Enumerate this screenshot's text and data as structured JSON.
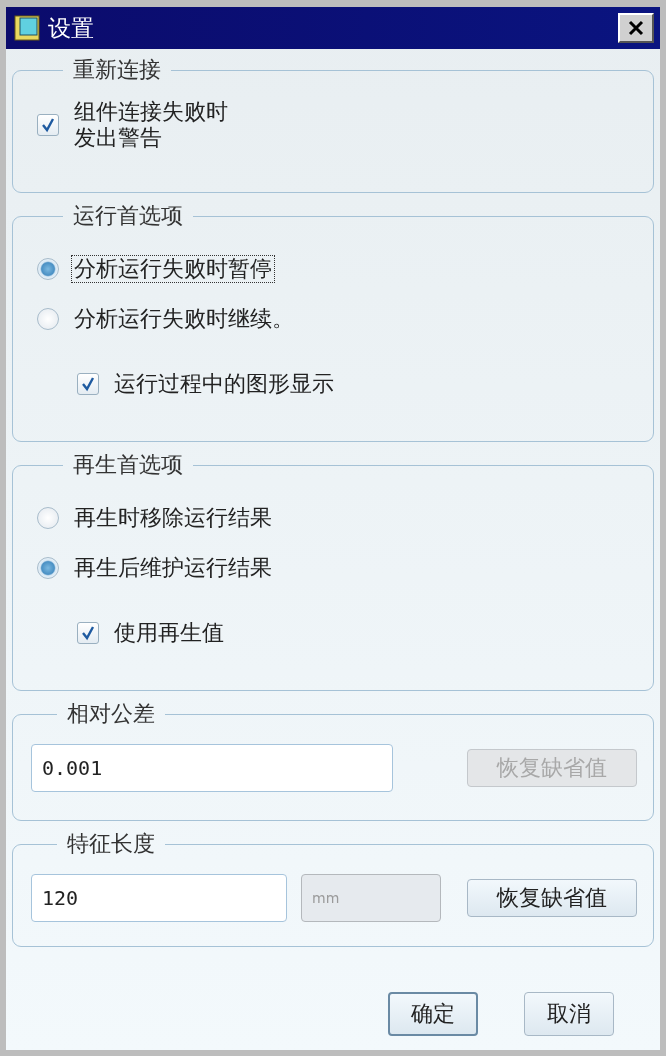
{
  "window": {
    "title": "设置"
  },
  "sections": [
    {
      "title": "重新连接",
      "items": [
        {
          "kind": "checkbox",
          "label": "组件连接失败时发出警告",
          "checked": true
        }
      ]
    },
    {
      "title": "运行首选项",
      "items": [
        {
          "kind": "radio",
          "label": "分析运行失败时暂停",
          "selected": true,
          "focused": true
        },
        {
          "kind": "radio",
          "label": "分析运行失败时继续。",
          "selected": false,
          "focused": false
        },
        {
          "kind": "sub_checkbox",
          "label": "运行过程中的图形显示",
          "checked": true
        }
      ]
    },
    {
      "title": "再生首选项",
      "items": [
        {
          "kind": "radio",
          "label": "再生时移除运行结果",
          "selected": false,
          "focused": false
        },
        {
          "kind": "radio",
          "label": "再生后维护运行结果",
          "selected": true,
          "focused": false
        },
        {
          "kind": "sub_checkbox",
          "label": "使用再生值",
          "checked": true
        }
      ]
    },
    {
      "title": "相对公差",
      "items": [
        {
          "kind": "field_row",
          "value": "0.001",
          "reset_button": {
            "label": "恢复缺省值",
            "disabled": true
          }
        }
      ]
    },
    {
      "title": "特征长度",
      "items": [
        {
          "kind": "field_row",
          "value": "120",
          "unit": "mm",
          "reset_button": {
            "label": "恢复缺省值",
            "disabled": false
          }
        }
      ]
    }
  ],
  "buttons": [
    {
      "label": "确定",
      "default": true
    },
    {
      "label": "取消",
      "default": false
    }
  ]
}
